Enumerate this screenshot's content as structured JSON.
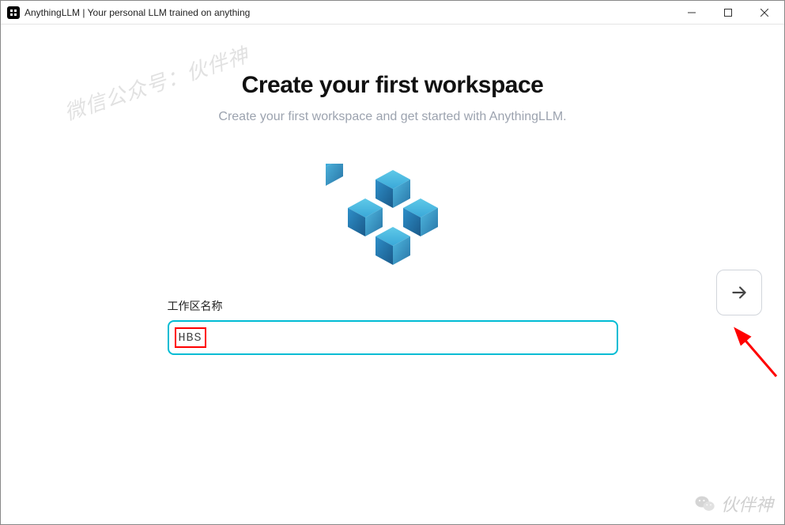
{
  "window": {
    "title": "AnythingLLM | Your personal LLM trained on anything",
    "icon_letters": "LLM"
  },
  "page": {
    "heading": "Create your first workspace",
    "subheading": "Create your first workspace and get started with AnythingLLM."
  },
  "form": {
    "label": "工作区名称",
    "value": "HBS"
  },
  "watermark": {
    "top_text": "微信公众号：伙伴神",
    "bottom_text": "伙伴神"
  }
}
